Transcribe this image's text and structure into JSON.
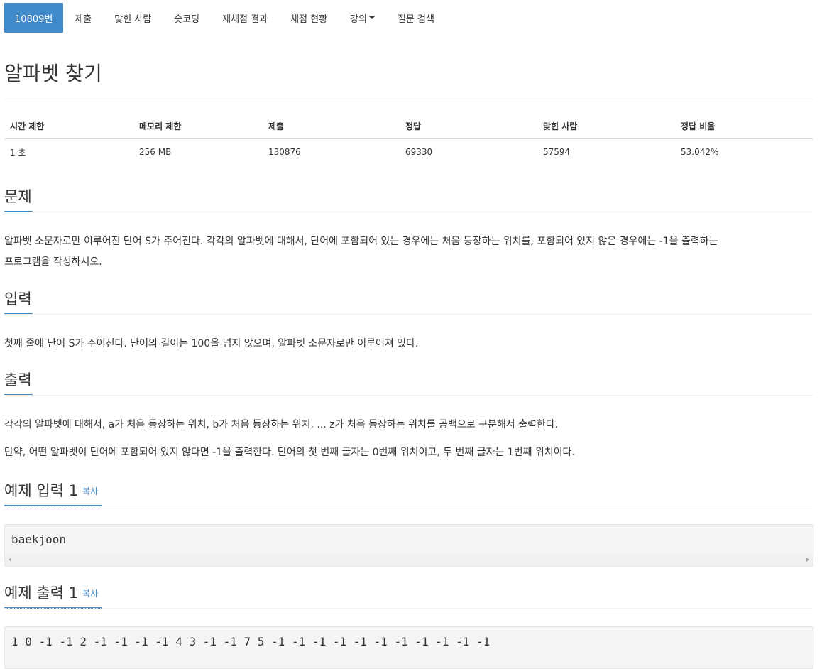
{
  "nav": {
    "items": [
      {
        "label": "10809번"
      },
      {
        "label": "제출"
      },
      {
        "label": "맞힌 사람"
      },
      {
        "label": "숏코딩"
      },
      {
        "label": "재채점 결과"
      },
      {
        "label": "채점 현황"
      },
      {
        "label": "강의"
      },
      {
        "label": "질문 검색"
      }
    ]
  },
  "problem": {
    "title": "알파벳 찾기",
    "info_headers": [
      "시간 제한",
      "메모리 제한",
      "제출",
      "정답",
      "맞힌 사람",
      "정답 비율"
    ],
    "info_values": [
      "1 초",
      "256 MB",
      "130876",
      "69330",
      "57594",
      "53.042%"
    ]
  },
  "sections": {
    "description_title": "문제",
    "description_lines": [
      "알파벳 소문자로만 이루어진 단어 S가 주어진다. 각각의 알파벳에 대해서, 단어에 포함되어 있는 경우에는 처음 등장하는 위치를, 포함되어 있지 않은 경우에는 -1을 출력하는",
      "프로그램을 작성하시오."
    ],
    "input_title": "입력",
    "input_text": "첫째 줄에 단어 S가 주어진다. 단어의 길이는 100을 넘지 않으며, 알파벳 소문자로만 이루어져 있다.",
    "output_title": "출력",
    "output_text_1": "각각의 알파벳에 대해서, a가 처음 등장하는 위치, b가 처음 등장하는 위치, ... z가 처음 등장하는 위치를 공백으로 구분해서 출력한다.",
    "output_text_2": "만약, 어떤 알파벳이 단어에 포함되어 있지 않다면 -1을 출력한다. 단어의 첫 번째 글자는 0번째 위치이고, 두 번째 글자는 1번째 위치이다."
  },
  "samples": {
    "input_title": "예제 입력",
    "input_num": "1",
    "input_copy": "복사",
    "input_text": "baekjoon",
    "output_title": "예제 출력",
    "output_num": "1",
    "output_copy": "복사",
    "output_text": "1 0 -1 -1 2 -1 -1 -1 -1 4 3 -1 -1 7 5 -1 -1 -1 -1 -1 -1 -1 -1 -1 -1 -1"
  },
  "colors": {
    "accent": "#428bca",
    "text": "#333333",
    "code_bg": "#f5f5f5"
  }
}
